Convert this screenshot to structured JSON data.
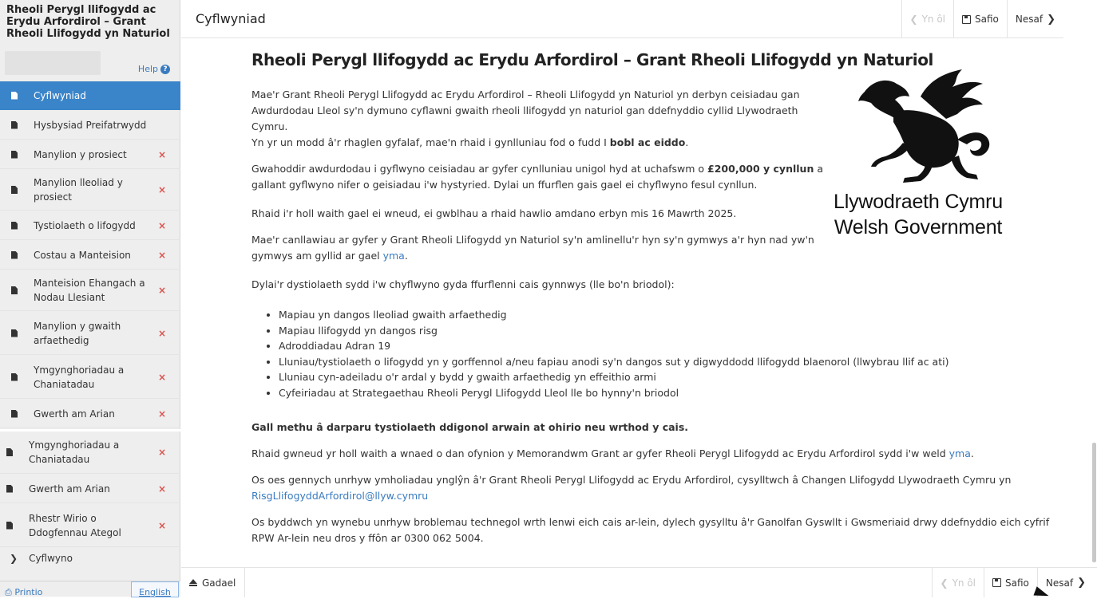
{
  "sidebar": {
    "title": "Rheoli Perygl llifogydd ac Erydu Arfordirol – Grant Rheoli Llifogydd yn Naturiol",
    "help": "Help",
    "items": [
      {
        "label": "Cyflwyniad",
        "active": true,
        "error": false
      },
      {
        "label": "Hysbysiad Preifatrwydd",
        "error": false
      },
      {
        "label": "Manylion y prosiect",
        "error": true
      },
      {
        "label": "Manylion lleoliad y prosiect",
        "error": true
      },
      {
        "label": "Tystiolaeth o lifogydd",
        "error": true
      },
      {
        "label": "Costau a Manteision",
        "error": true
      },
      {
        "label": "Manteision Ehangach a Nodau Llesiant",
        "error": true
      },
      {
        "label": "Manylion y gwaith arfaethedig",
        "error": true
      },
      {
        "label": "Ymgynghoriadau a Chaniatadau",
        "error": true
      },
      {
        "label": "Gwerth am Arian",
        "error": true
      },
      {
        "label": "Ymgynghoriadau a Chaniatadau",
        "error": true
      },
      {
        "label": "Gwerth am Arian",
        "error": true
      },
      {
        "label": "Rhestr Wirio o Ddogfennau Ategol",
        "error": true
      },
      {
        "label": "Cyflwyno",
        "error": false
      }
    ],
    "error_mark": "×",
    "print": "Printio",
    "english": "English"
  },
  "topbar": {
    "title": "Cyflwyniad",
    "back": "Yn ôl",
    "save": "Safio",
    "next": "Nesaf"
  },
  "content": {
    "title": "Rheoli Perygl llifogydd ac Erydu Arfordirol – Grant Rheoli Llifogydd yn Naturiol",
    "p1": "Mae'r Grant Rheoli Perygl Llifogydd ac Erydu Arfordirol – Rheoli Llifogydd yn Naturiol yn derbyn ceisiadau gan Awdurdodau Lleol sy'n dymuno cyflawni gwaith rheoli llifogydd yn naturiol gan ddefnyddio cyllid Llywodraeth Cymru.",
    "p2_a": "Yn yr un modd â'r rhaglen gyfalaf, mae'n rhaid i gynlluniau fod o fudd I ",
    "p2_b": "bobl ac eiddo",
    "p2_c": ".",
    "p3_a": "Gwahoddir awdurdodau i gyflwyno ceisiadau ar gyfer cynlluniau unigol hyd at uchafswm o ",
    "p3_b": "£200,000 y cynllun",
    "p3_c": " a gallant gyflwyno nifer o geisiadau i'w hystyried. Dylai un ffurflen gais gael ei chyflwyno fesul cynllun.",
    "p4": "Rhaid i'r holl waith gael ei wneud, ei gwblhau a rhaid hawlio amdano erbyn mis 16 Mawrth 2025.",
    "p5_a": "Mae'r canllawiau ar gyfer y Grant Rheoli Llifogydd yn Naturiol sy'n amlinellu'r hyn sy'n gymwys a'r hyn nad yw'n gymwys am gyllid ar gael ",
    "p5_link": "yma",
    "p5_c": ".",
    "p6": "Dylai'r dystiolaeth sydd i'w chyflwyno gyda ffurflenni cais gynnwys (lle bo'n briodol):",
    "bullets": [
      "Mapiau yn dangos lleoliad gwaith arfaethedig",
      "Mapiau llifogydd yn dangos risg",
      "Adroddiadau Adran 19",
      "Lluniau/tystiolaeth o lifogydd yn y gorffennol a/neu fapiau anodi sy'n dangos sut y digwyddodd llifogydd blaenorol (llwybrau llif ac ati)",
      "Lluniau cyn-adeiladu o'r ardal y bydd y gwaith arfaethedig yn effeithio armi",
      "Cyfeiriadau at Strategaethau Rheoli Perygl Llifogydd Lleol lle bo hynny'n briodol"
    ],
    "warning": "Gall methu â darparu tystiolaeth ddigonol arwain at ohirio neu wrthod y cais.",
    "p7_a": "Rhaid gwneud yr holl waith a wnaed o dan ofynion y Memorandwm Grant ar gyfer Rheoli Perygl Llifogydd ac Erydu Arfordirol sydd i'w weld ",
    "p7_link": "yma",
    "p7_c": ".",
    "p8_a": "Os oes gennych unrhyw ymholiadau ynglŷn â'r Grant Rheoli Perygl Llifogydd ac Erydu Arfordirol, cysylltwch â Changen Llifogydd Llywodraeth Cymru yn",
    "p8_link": "RisgLlifogyddArfordirol@llyw.cymru",
    "p9": "Os byddwch yn wynebu unrhyw broblemau technegol wrth lenwi eich cais ar-lein, dylech gysylltu â'r Ganolfan Gyswllt i Gwsmeriaid drwy ddefnyddio eich cyfrif RPW Ar-lein neu dros y ffôn ar 0300 062 5004."
  },
  "logo": {
    "welsh": "Llywodraeth Cymru",
    "english": "Welsh Government"
  },
  "bottombar": {
    "leave": "Gadael",
    "back": "Yn ôl",
    "save": "Safio",
    "next": "Nesaf"
  }
}
